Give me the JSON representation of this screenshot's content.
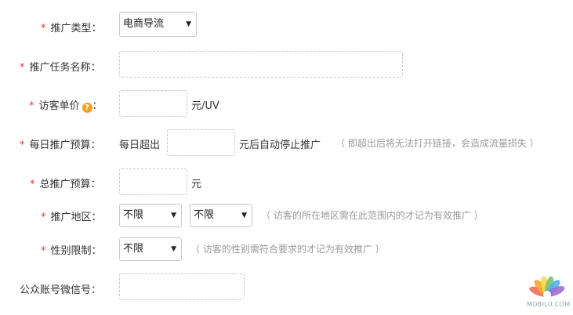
{
  "form": {
    "promo_type": {
      "label": "推广类型：",
      "value": "电商导流"
    },
    "task_name": {
      "label": "推广任务名称：",
      "value": ""
    },
    "unit_price": {
      "label": "访客单价",
      "colon": "：",
      "help": "?",
      "unit": "元/UV",
      "value": ""
    },
    "daily_budget": {
      "label": "每日推广预算：",
      "prefix": "每日超出",
      "suffix": "元后自动停止推广",
      "hint": "（ 即超出后将无法打开链接，会造成流量损失 ）",
      "value": ""
    },
    "total_budget": {
      "label": "总推广预算：",
      "unit": "元",
      "value": ""
    },
    "region": {
      "label": "推广地区：",
      "select1": "不限",
      "select2": "不限",
      "hint": "（ 访客的所在地区需在此范围内的才记为有效推广 ）"
    },
    "gender": {
      "label": "性别限制：",
      "value": "不限",
      "hint": "（ 访客的性别需符合要求的才记为有效推广 ）"
    },
    "wechat": {
      "label": "公众账号微信号：",
      "value": ""
    },
    "required_mark": "*"
  },
  "watermark": {
    "text": "MOBILU.COM"
  }
}
